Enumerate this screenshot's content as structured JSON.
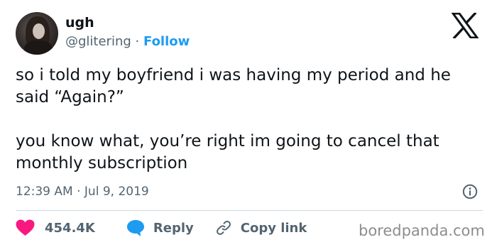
{
  "author": {
    "display_name": "ugh",
    "handle": "@glitering",
    "separator": "·",
    "follow_label": "Follow"
  },
  "tweet": {
    "paragraphs": [
      "so i told my boyfriend i was having my period and he said “Again?”",
      "you know what, you’re right im going to cancel that monthly subscription"
    ],
    "timestamp": "12:39 AM · Jul 9, 2019"
  },
  "actions": {
    "like_count": "454.4K",
    "reply_label": "Reply",
    "copy_link_label": "Copy link"
  },
  "watermark": "boredpanda.com",
  "icons": {
    "brand": "x-logo-icon",
    "info": "info-icon",
    "like": "heart-icon",
    "reply": "speech-bubble-icon",
    "copy": "link-icon"
  },
  "colors": {
    "text": "#0f1419",
    "secondary": "#536471",
    "follow": "#1d9bf0",
    "heart": "#f91880",
    "reply_bubble": "#1d9bf0",
    "divider": "#cfd9de"
  }
}
